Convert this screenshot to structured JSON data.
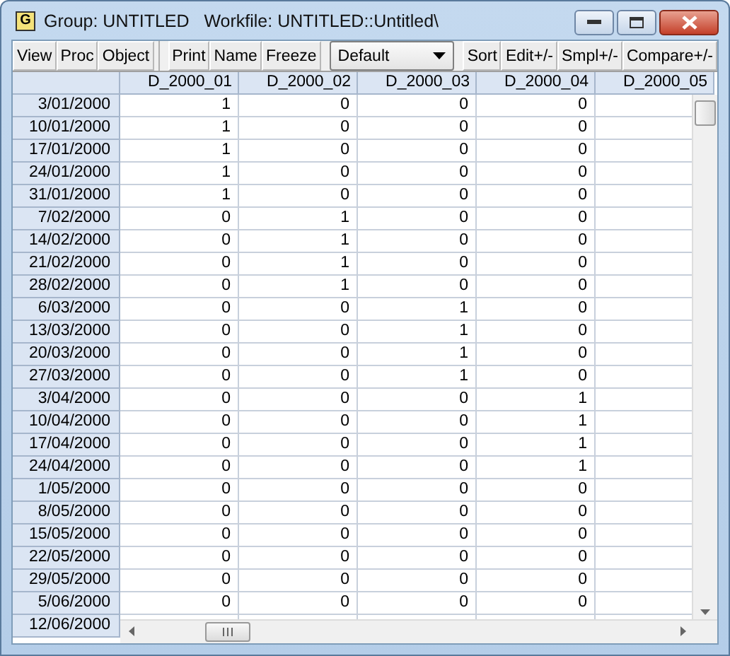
{
  "window": {
    "icon_letter": "G",
    "title": "Group: UNTITLED   Workfile: UNTITLED::Untitled\\"
  },
  "toolbar": [
    {
      "kind": "button",
      "label": "View"
    },
    {
      "kind": "button",
      "label": "Proc"
    },
    {
      "kind": "button",
      "label": "Object"
    },
    {
      "kind": "separator"
    },
    {
      "kind": "button",
      "label": "Print"
    },
    {
      "kind": "button",
      "label": "Name"
    },
    {
      "kind": "button",
      "label": "Freeze"
    },
    {
      "kind": "dropdown",
      "label": "Default"
    },
    {
      "kind": "button",
      "label": "Sort"
    },
    {
      "kind": "button",
      "label": "Edit+/-"
    },
    {
      "kind": "button",
      "label": "Smpl+/-"
    },
    {
      "kind": "button",
      "label": "Compare+/-"
    }
  ],
  "table": {
    "columns": [
      "D_2000_01",
      "D_2000_02",
      "D_2000_03",
      "D_2000_04",
      "D_2000_05"
    ],
    "rows": [
      {
        "label": "3/01/2000",
        "values": [
          "1",
          "0",
          "0",
          "0"
        ]
      },
      {
        "label": "10/01/2000",
        "values": [
          "1",
          "0",
          "0",
          "0"
        ]
      },
      {
        "label": "17/01/2000",
        "values": [
          "1",
          "0",
          "0",
          "0"
        ]
      },
      {
        "label": "24/01/2000",
        "values": [
          "1",
          "0",
          "0",
          "0"
        ]
      },
      {
        "label": "31/01/2000",
        "values": [
          "1",
          "0",
          "0",
          "0"
        ]
      },
      {
        "label": "7/02/2000",
        "values": [
          "0",
          "1",
          "0",
          "0"
        ]
      },
      {
        "label": "14/02/2000",
        "values": [
          "0",
          "1",
          "0",
          "0"
        ]
      },
      {
        "label": "21/02/2000",
        "values": [
          "0",
          "1",
          "0",
          "0"
        ]
      },
      {
        "label": "28/02/2000",
        "values": [
          "0",
          "1",
          "0",
          "0"
        ]
      },
      {
        "label": "6/03/2000",
        "values": [
          "0",
          "0",
          "1",
          "0"
        ]
      },
      {
        "label": "13/03/2000",
        "values": [
          "0",
          "0",
          "1",
          "0"
        ]
      },
      {
        "label": "20/03/2000",
        "values": [
          "0",
          "0",
          "1",
          "0"
        ]
      },
      {
        "label": "27/03/2000",
        "values": [
          "0",
          "0",
          "1",
          "0"
        ]
      },
      {
        "label": "3/04/2000",
        "values": [
          "0",
          "0",
          "0",
          "1"
        ]
      },
      {
        "label": "10/04/2000",
        "values": [
          "0",
          "0",
          "0",
          "1"
        ]
      },
      {
        "label": "17/04/2000",
        "values": [
          "0",
          "0",
          "0",
          "1"
        ]
      },
      {
        "label": "24/04/2000",
        "values": [
          "0",
          "0",
          "0",
          "1"
        ]
      },
      {
        "label": "1/05/2000",
        "values": [
          "0",
          "0",
          "0",
          "0"
        ]
      },
      {
        "label": "8/05/2000",
        "values": [
          "0",
          "0",
          "0",
          "0"
        ]
      },
      {
        "label": "15/05/2000",
        "values": [
          "0",
          "0",
          "0",
          "0"
        ]
      },
      {
        "label": "22/05/2000",
        "values": [
          "0",
          "0",
          "0",
          "0"
        ]
      },
      {
        "label": "29/05/2000",
        "values": [
          "0",
          "0",
          "0",
          "0"
        ]
      },
      {
        "label": "5/06/2000",
        "values": [
          "0",
          "0",
          "0",
          "0"
        ]
      }
    ],
    "partial_row_label": "12/06/2000"
  }
}
